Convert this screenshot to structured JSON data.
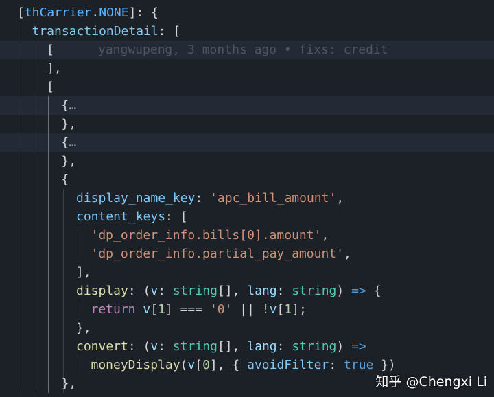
{
  "editor": {
    "theme": {
      "background": "#1c2027",
      "highlight_line": "#232a35",
      "string": "#ce9178",
      "type": "#4ec9b0",
      "keyword": "#c586c0",
      "property": "#7ec8f5",
      "variable": "#5ab3ff"
    },
    "lines": [
      {
        "indent": 0,
        "guides": [],
        "tokens": [
          {
            "t": "[",
            "c": "punc"
          },
          {
            "t": "thCarrier",
            "c": "var"
          },
          {
            "t": ".",
            "c": "punc"
          },
          {
            "t": "NONE",
            "c": "const"
          },
          {
            "t": "]: {",
            "c": "punc"
          }
        ]
      },
      {
        "indent": 1,
        "guides": [
          0
        ],
        "tokens": [
          {
            "t": "transactionDetail",
            "c": "prop"
          },
          {
            "t": ": [",
            "c": "punc"
          }
        ]
      },
      {
        "indent": 2,
        "guides": [
          0,
          1
        ],
        "highlight": true,
        "tokens": [
          {
            "t": "[",
            "c": "punc"
          }
        ],
        "blame": "yangwupeng, 3 months ago • fixs: credit"
      },
      {
        "indent": 2,
        "guides": [
          0,
          1
        ],
        "tokens": [
          {
            "t": "],",
            "c": "punc"
          }
        ]
      },
      {
        "indent": 2,
        "guides": [
          0,
          1
        ],
        "tokens": [
          {
            "t": "[",
            "c": "punc"
          }
        ]
      },
      {
        "indent": 3,
        "guides": [
          0,
          1,
          2
        ],
        "highlight": true,
        "tokens": [
          {
            "t": "{",
            "c": "punc"
          },
          {
            "t": "…",
            "c": "fold"
          }
        ]
      },
      {
        "indent": 3,
        "guides": [
          0,
          1,
          2
        ],
        "tokens": [
          {
            "t": "},",
            "c": "punc"
          }
        ]
      },
      {
        "indent": 3,
        "guides": [
          0,
          1,
          2
        ],
        "highlight": true,
        "tokens": [
          {
            "t": "{",
            "c": "punc"
          },
          {
            "t": "…",
            "c": "fold"
          }
        ]
      },
      {
        "indent": 3,
        "guides": [
          0,
          1,
          2
        ],
        "tokens": [
          {
            "t": "},",
            "c": "punc"
          }
        ]
      },
      {
        "indent": 3,
        "guides": [
          0,
          1,
          2
        ],
        "tokens": [
          {
            "t": "{",
            "c": "punc"
          }
        ]
      },
      {
        "indent": 4,
        "guides": [
          0,
          1,
          2,
          3
        ],
        "tokens": [
          {
            "t": "display_name_key",
            "c": "prop"
          },
          {
            "t": ": ",
            "c": "punc"
          },
          {
            "t": "'apc_bill_amount'",
            "c": "str"
          },
          {
            "t": ",",
            "c": "punc"
          }
        ]
      },
      {
        "indent": 4,
        "guides": [
          0,
          1,
          2,
          3
        ],
        "tokens": [
          {
            "t": "content_keys",
            "c": "prop"
          },
          {
            "t": ": [",
            "c": "punc"
          }
        ]
      },
      {
        "indent": 5,
        "guides": [
          0,
          1,
          2,
          3,
          4
        ],
        "tokens": [
          {
            "t": "'dp_order_info.bills[0].amount'",
            "c": "str"
          },
          {
            "t": ",",
            "c": "punc"
          }
        ]
      },
      {
        "indent": 5,
        "guides": [
          0,
          1,
          2,
          3,
          4
        ],
        "tokens": [
          {
            "t": "'dp_order_info.partial_pay_amount'",
            "c": "str"
          },
          {
            "t": ",",
            "c": "punc"
          }
        ]
      },
      {
        "indent": 4,
        "guides": [
          0,
          1,
          2,
          3
        ],
        "tokens": [
          {
            "t": "],",
            "c": "punc"
          }
        ]
      },
      {
        "indent": 4,
        "guides": [
          0,
          1,
          2,
          3
        ],
        "tokens": [
          {
            "t": "display",
            "c": "fn"
          },
          {
            "t": ": (",
            "c": "punc"
          },
          {
            "t": "v",
            "c": "param"
          },
          {
            "t": ": ",
            "c": "punc"
          },
          {
            "t": "string",
            "c": "type"
          },
          {
            "t": "[], ",
            "c": "punc"
          },
          {
            "t": "lang",
            "c": "param"
          },
          {
            "t": ": ",
            "c": "punc"
          },
          {
            "t": "string",
            "c": "type"
          },
          {
            "t": ") ",
            "c": "punc"
          },
          {
            "t": "=>",
            "c": "arrow"
          },
          {
            "t": " {",
            "c": "punc"
          }
        ]
      },
      {
        "indent": 5,
        "guides": [
          0,
          1,
          2,
          3,
          4
        ],
        "tokens": [
          {
            "t": "return",
            "c": "kw"
          },
          {
            "t": " ",
            "c": "punc"
          },
          {
            "t": "v",
            "c": "param"
          },
          {
            "t": "[",
            "c": "punc"
          },
          {
            "t": "1",
            "c": "num"
          },
          {
            "t": "] === ",
            "c": "punc"
          },
          {
            "t": "'0'",
            "c": "str"
          },
          {
            "t": " || !",
            "c": "punc"
          },
          {
            "t": "v",
            "c": "param"
          },
          {
            "t": "[",
            "c": "punc"
          },
          {
            "t": "1",
            "c": "num"
          },
          {
            "t": "];",
            "c": "punc"
          }
        ]
      },
      {
        "indent": 4,
        "guides": [
          0,
          1,
          2,
          3
        ],
        "tokens": [
          {
            "t": "},",
            "c": "punc"
          }
        ]
      },
      {
        "indent": 4,
        "guides": [
          0,
          1,
          2,
          3
        ],
        "tokens": [
          {
            "t": "convert",
            "c": "fn"
          },
          {
            "t": ": (",
            "c": "punc"
          },
          {
            "t": "v",
            "c": "param"
          },
          {
            "t": ": ",
            "c": "punc"
          },
          {
            "t": "string",
            "c": "type"
          },
          {
            "t": "[], ",
            "c": "punc"
          },
          {
            "t": "lang",
            "c": "param"
          },
          {
            "t": ": ",
            "c": "punc"
          },
          {
            "t": "string",
            "c": "type"
          },
          {
            "t": ") ",
            "c": "punc"
          },
          {
            "t": "=>",
            "c": "arrow"
          }
        ]
      },
      {
        "indent": 5,
        "guides": [
          0,
          1,
          2,
          3,
          4
        ],
        "tokens": [
          {
            "t": "moneyDisplay",
            "c": "fn"
          },
          {
            "t": "(",
            "c": "punc"
          },
          {
            "t": "v",
            "c": "param"
          },
          {
            "t": "[",
            "c": "punc"
          },
          {
            "t": "0",
            "c": "num"
          },
          {
            "t": "], { ",
            "c": "punc"
          },
          {
            "t": "avoidFilter",
            "c": "prop"
          },
          {
            "t": ": ",
            "c": "punc"
          },
          {
            "t": "true",
            "c": "arrow"
          },
          {
            "t": " })",
            "c": "punc"
          }
        ]
      },
      {
        "indent": 3,
        "guides": [
          0,
          1,
          2,
          3
        ],
        "tokens": [
          {
            "t": "},",
            "c": "punc"
          }
        ]
      }
    ]
  },
  "watermark": {
    "text": "知乎 @Chengxi Li"
  }
}
